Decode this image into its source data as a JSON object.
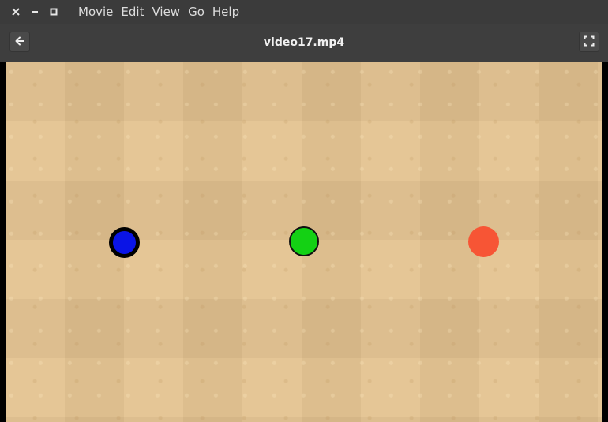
{
  "window": {
    "controls": [
      "close",
      "minimize",
      "maximize"
    ]
  },
  "menu": {
    "items": [
      "Movie",
      "Edit",
      "View",
      "Go",
      "Help"
    ]
  },
  "header": {
    "title": "video17.mp4",
    "back_icon": "arrow-left-icon",
    "fullscreen_icon": "fullscreen-icon"
  },
  "video": {
    "background_color": "#e3c28f",
    "balls": [
      {
        "name": "blue-ball",
        "fill": "#0a14e6",
        "outline": "#000000"
      },
      {
        "name": "green-ball",
        "fill": "#14d114",
        "outline": "#111111"
      },
      {
        "name": "red-ball",
        "fill": "#f75535",
        "outline": "none"
      }
    ]
  }
}
